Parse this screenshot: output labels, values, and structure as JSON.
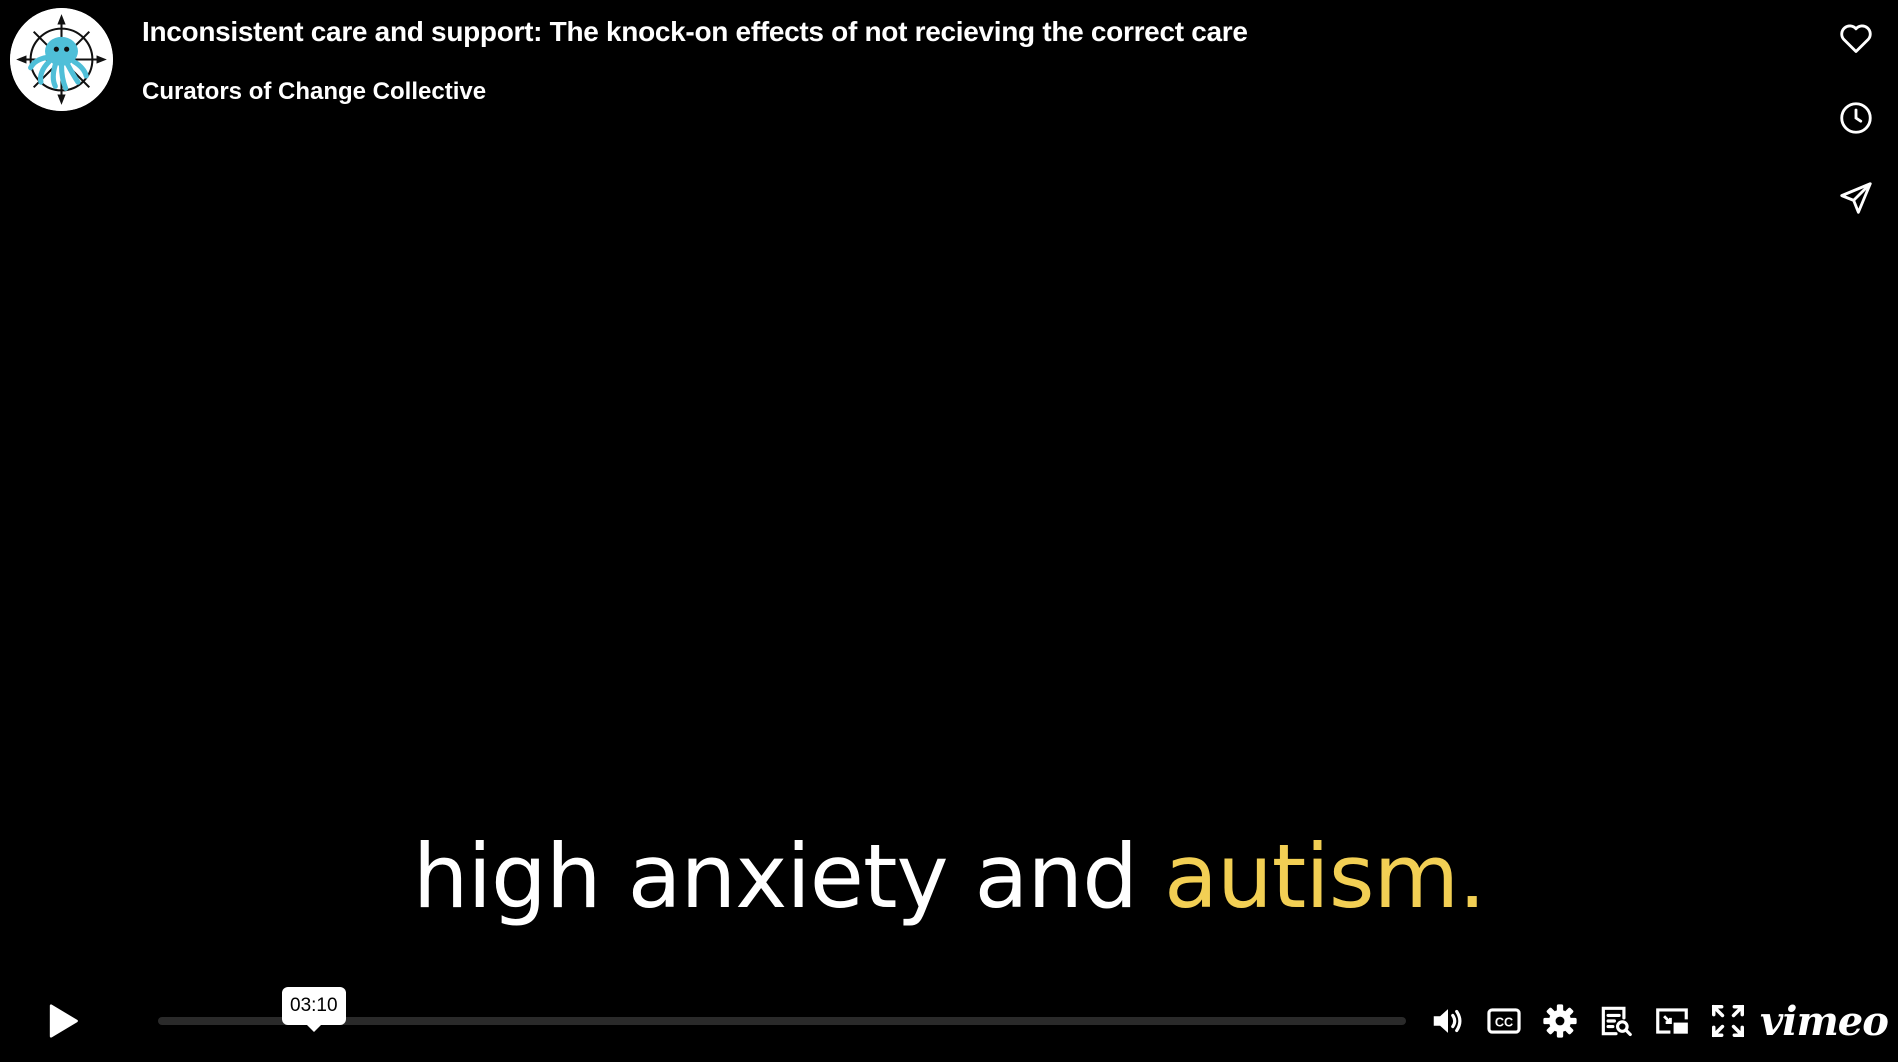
{
  "video": {
    "title": "Inconsistent care and support: The knock-on effects of not recieving the correct care",
    "author": "Curators of Change Collective"
  },
  "side_actions": [
    {
      "icon": "heart-icon"
    },
    {
      "icon": "clock-icon"
    },
    {
      "icon": "send-icon"
    }
  ],
  "captions": {
    "text_main": "high anxiety and",
    "text_highlight": "autism.",
    "highlight_color": "#f2cf54"
  },
  "player": {
    "hover_time": "03:10",
    "progress_fraction": 0.0,
    "controls": [
      "play-icon",
      "volume-icon",
      "closed-captions-icon",
      "settings-gear-icon",
      "transcript-icon",
      "picture-in-picture-icon",
      "fullscreen-icon"
    ],
    "brand": "vimeo"
  },
  "colors": {
    "background": "#000000",
    "text": "#ffffff",
    "track": "#2a2a2a"
  }
}
